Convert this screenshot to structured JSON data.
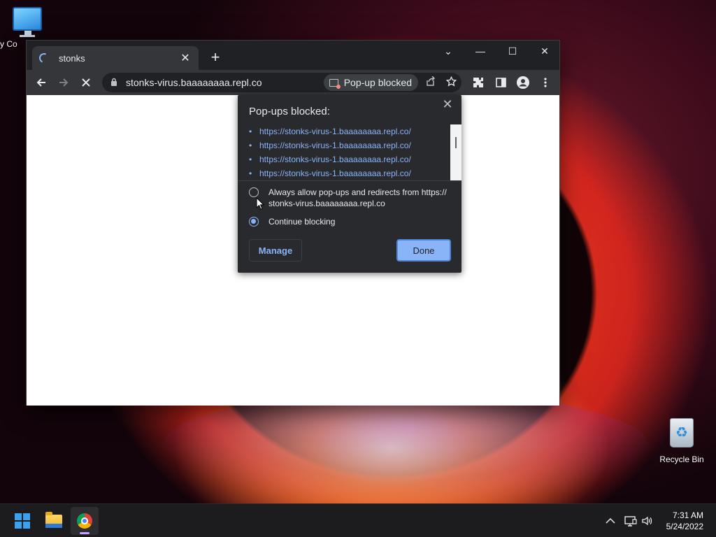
{
  "desktop": {
    "icons": [
      {
        "label": "My Co"
      },
      {
        "label": "Recycle Bin"
      }
    ]
  },
  "browser": {
    "tab_title": "stonks",
    "tab_close_glyph": "✕",
    "new_tab_glyph": "+",
    "window_controls": {
      "tab_search": "⌄",
      "minimize": "—",
      "maximize": "☐",
      "close": "✕"
    },
    "url": "stonks-virus.baaaaaaaa.repl.co",
    "popup_chip_label": "Pop-up blocked",
    "icons": [
      "back-arrow-icon",
      "forward-arrow-icon",
      "stop-loading-icon",
      "lock-icon",
      "popup-blocked-icon",
      "share-icon",
      "star-icon",
      "extensions-icon",
      "side-panel-icon",
      "profile-icon",
      "menu-dots-icon"
    ]
  },
  "popup_bubble": {
    "title": "Pop-ups blocked:",
    "close_glyph": "✕",
    "blocked_urls": [
      "https://stonks-virus-1.baaaaaaaa.repl.co/",
      "https://stonks-virus-1.baaaaaaaa.repl.co/",
      "https://stonks-virus-1.baaaaaaaa.repl.co/",
      "https://stonks-virus-1.baaaaaaaa.repl.co/"
    ],
    "option_allow_line1": "Always allow pop-ups and redirects from https://",
    "option_allow_line2": "stonks-virus.baaaaaaaa.repl.co",
    "option_block": "Continue blocking",
    "selected_option": "Continue blocking",
    "manage_label": "Manage",
    "done_label": "Done"
  },
  "taskbar": {
    "time": "7:31 AM",
    "date": "5/24/2022",
    "tray_icons": [
      "chevron-up-icon",
      "network-icon",
      "volume-icon"
    ]
  },
  "colors": {
    "accent_link": "#8ab4f8",
    "chrome_dark": "#202124",
    "toolbar": "#35363a"
  }
}
